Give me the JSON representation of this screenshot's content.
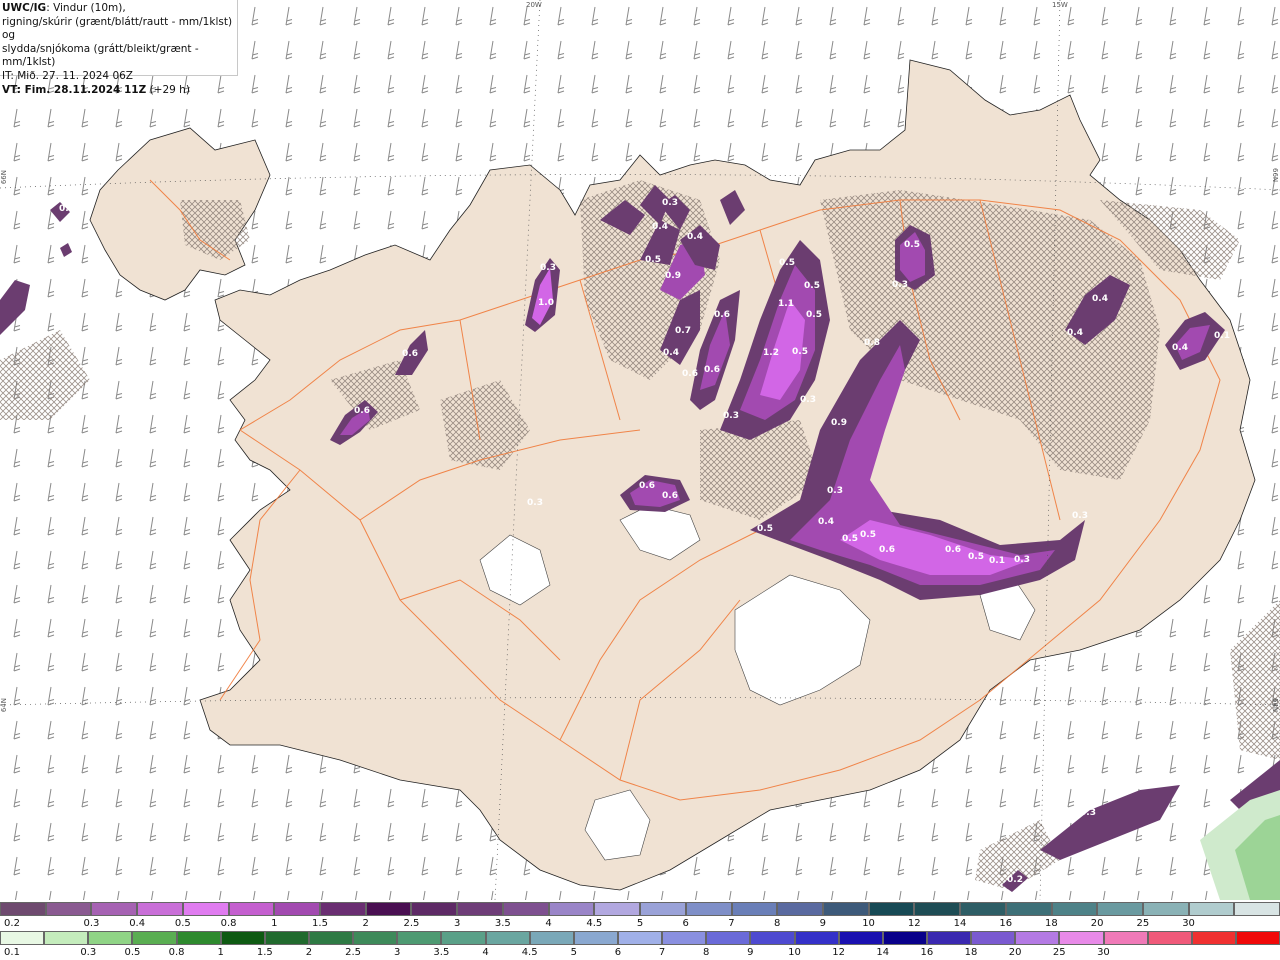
{
  "header": {
    "product": "UWC/IG",
    "line1_rest": ": Vindur (10m),",
    "line2": "rigning/skúrir (grænt/blátt/rautt - mm/1klst) og",
    "line3": "slydda/snjókoma (grátt/bleikt/grænt - mm/1klst)",
    "line4": "IT: Mið. 27. 11. 2024 06Z",
    "line5_bold": "VT: Fim. 28.11.2024 11Z",
    "line5_rest": " (+29 h)"
  },
  "grid_labels": {
    "top_20w": "20W",
    "top_15w": "15W",
    "left_66n": "66N",
    "right_66n": "66N",
    "left_64n": "64N",
    "right_64n": "64N"
  },
  "colors": {
    "land": "#f0e2d3",
    "road": "#f07a3a",
    "precip_dark": "#6b3d70",
    "precip_mid": "#a24ab0",
    "precip_light": "#d266e6",
    "barb": "#8a8a8a"
  },
  "precip_labels": [
    {
      "text": "0.3"
    },
    {
      "text": "0.2"
    },
    {
      "text": "1.0"
    },
    {
      "text": "0.3"
    },
    {
      "text": "0.6"
    },
    {
      "text": "0.6"
    },
    {
      "text": "0.3"
    },
    {
      "text": "0.4"
    },
    {
      "text": "0.9"
    },
    {
      "text": "0.5"
    },
    {
      "text": "0.4"
    },
    {
      "text": "0.7"
    },
    {
      "text": "0.6"
    },
    {
      "text": "0.4"
    },
    {
      "text": "0.6"
    },
    {
      "text": "0.6"
    },
    {
      "text": "1.1"
    },
    {
      "text": "1.2"
    },
    {
      "text": "0.5"
    },
    {
      "text": "0.5"
    },
    {
      "text": "0.5"
    },
    {
      "text": "0.5"
    },
    {
      "text": "0.8"
    },
    {
      "text": "0.3"
    },
    {
      "text": "0.5"
    },
    {
      "text": "0.3"
    },
    {
      "text": "0.4"
    },
    {
      "text": "0.4"
    },
    {
      "text": "0.4"
    },
    {
      "text": "0.9"
    },
    {
      "text": "0.3"
    },
    {
      "text": "0.3"
    },
    {
      "text": "0.6"
    },
    {
      "text": "0.6"
    },
    {
      "text": "0.3"
    },
    {
      "text": "0.5"
    },
    {
      "text": "0.4"
    },
    {
      "text": "0.5"
    },
    {
      "text": "0.5"
    },
    {
      "text": "0.6"
    },
    {
      "text": "0.6"
    },
    {
      "text": "0.5"
    },
    {
      "text": "0.1"
    },
    {
      "text": "0.3"
    },
    {
      "text": "0.3"
    },
    {
      "text": "0.3"
    },
    {
      "text": "0.2"
    },
    {
      "text": "0.1"
    }
  ],
  "legend": {
    "row1_colors": [
      "#6e4a6f",
      "#8a5a91",
      "#a662b3",
      "#c96fd8",
      "#e07cf0",
      "#c45fcf",
      "#a24ab0",
      "#6a2e72",
      "#4a0f52",
      "#5e2a66",
      "#6e3d78",
      "#7e5090",
      "#9a85c8",
      "#b2a8e0",
      "#9aa2d8",
      "#7f8fc8",
      "#6a7fb8",
      "#5a6aa0",
      "#3d5a7a",
      "#174a55",
      "#1e4d55",
      "#2e5e66",
      "#3e7078",
      "#4e8288",
      "#6a9aa0",
      "#8ab2b6",
      "#b0ccce",
      "#d8e4e4"
    ],
    "row1_ticks": [
      "0.2",
      "0.3",
      "0.4",
      "0.5",
      "0.8",
      "1",
      "1.5",
      "2",
      "2.5",
      "3",
      "3.5",
      "4",
      "4.5",
      "5",
      "6",
      "7",
      "8",
      "9",
      "10",
      "12",
      "14",
      "16",
      "18",
      "20",
      "25",
      "30"
    ],
    "row2_colors": [
      "#e8f8e4",
      "#c4ecbc",
      "#90d486",
      "#5aae52",
      "#2e8a2e",
      "#0e5a12",
      "#216a2e",
      "#2e7a44",
      "#3e8a5a",
      "#4e9a72",
      "#5aa088",
      "#6aa6a0",
      "#7aa8b8",
      "#8aa8d0",
      "#a0b0e8",
      "#8a90e0",
      "#6a6ad8",
      "#4e4ad0",
      "#3430c8",
      "#1a10b0",
      "#08008a",
      "#3a28b0",
      "#7a5ad0",
      "#b47ae4",
      "#e88ae8",
      "#f07ab8",
      "#f05a7a",
      "#f03030",
      "#f00808"
    ],
    "row2_ticks": [
      "0.1",
      "0.3",
      "0.5",
      "0.8",
      "1",
      "1.5",
      "2",
      "2.5",
      "3",
      "3.5",
      "4",
      "4.5",
      "5",
      "6",
      "7",
      "8",
      "9",
      "10",
      "12",
      "14",
      "16",
      "18",
      "20",
      "25",
      "30"
    ]
  }
}
